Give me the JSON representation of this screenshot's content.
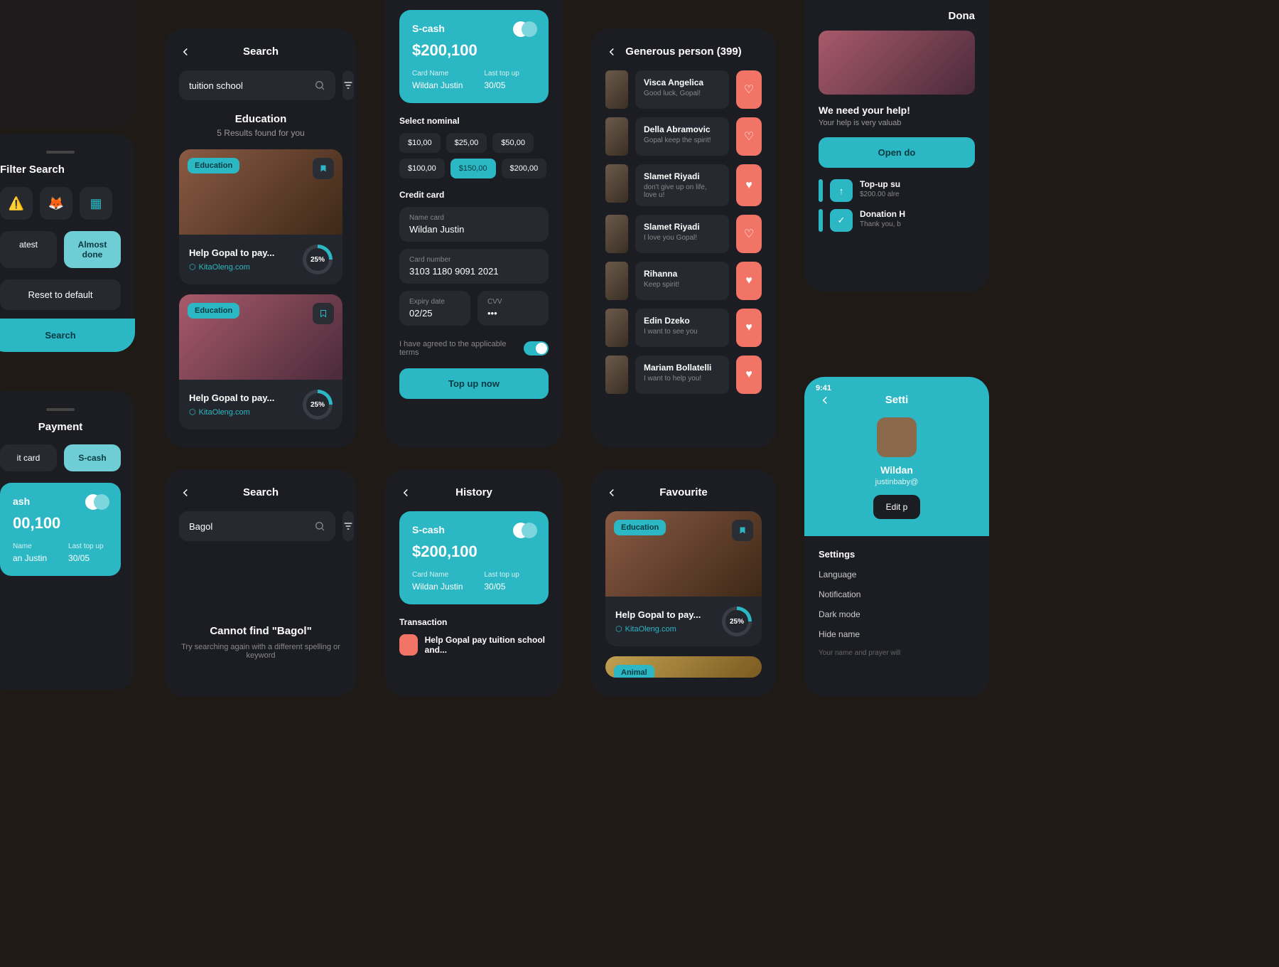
{
  "filter_panel": {
    "title": "Filter Search",
    "icons": [
      "⚠️",
      "🦊",
      "▦"
    ],
    "sort": {
      "latest": "atest",
      "almost_done": "Almost done"
    },
    "reset": "Reset to default",
    "search": "Search"
  },
  "payment_panel": {
    "title": "Payment",
    "tabs": {
      "credit": "it card",
      "scash": "S-cash"
    }
  },
  "scash_card": {
    "name": "S-cash",
    "amount": "$200,100",
    "card_name_label": "Card Name",
    "card_name": "Wildan Justin",
    "topup_label": "Last top up",
    "topup": "30/05"
  },
  "scash_card2": {
    "name": "ash",
    "amount": "00,100",
    "card_name_label": "Name",
    "card_name": "an Justin",
    "topup_label": "Last top up",
    "topup": "30/05"
  },
  "scash_card3": {
    "name": "S-cash",
    "amount": "$200,100",
    "card_name_label": "Card Name",
    "card_name": "Wildan Justin",
    "topup_label": "Last top up",
    "topup": "30/05"
  },
  "search_screen": {
    "title": "Search",
    "query": "tuition school",
    "category": "Education",
    "results_text": "5 Results found for you",
    "cards": [
      {
        "badge": "Education",
        "title": "Help Gopal to pay...",
        "source": "KitaOleng.com",
        "progress": "25%"
      },
      {
        "badge": "Education",
        "title": "Help Gopal to pay...",
        "source": "KitaOleng.com",
        "progress": "25%"
      }
    ]
  },
  "search_empty": {
    "title": "Search",
    "query": "Bagol",
    "nf_title": "Cannot find \"Bagol\"",
    "nf_sub": "Try searching again with a different spelling or keyword"
  },
  "topup_screen": {
    "select_label": "Select nominal",
    "nominals": [
      "$10,00",
      "$25,00",
      "$50,00",
      "$100,00",
      "$150,00",
      "$200,00"
    ],
    "selected_index": 4,
    "cc_label": "Credit card",
    "fields": {
      "name_label": "Name card",
      "name": "Wildan Justin",
      "number_label": "Card number",
      "number": "3103 1180 9091 2021",
      "expiry_label": "Expiry date",
      "expiry": "02/25",
      "cvv_label": "CVV",
      "cvv": "•••"
    },
    "terms": "I have agreed to the applicable terms",
    "button": "Top up now"
  },
  "history_screen": {
    "title": "History",
    "txn_label": "Transaction",
    "txn_item": "Help Gopal pay tuition school and..."
  },
  "generous_screen": {
    "title": "Generous person (399)",
    "people": [
      {
        "name": "Visca Angelica",
        "msg": "Good luck, Gopal!"
      },
      {
        "name": "Della Abramovic",
        "msg": "Gopal keep the spirit!"
      },
      {
        "name": "Slamet Riyadi",
        "msg": "don't give up on life, love u!"
      },
      {
        "name": "Slamet Riyadi",
        "msg": "I love you Gopal!"
      },
      {
        "name": "Rihanna",
        "msg": "Keep spirit!"
      },
      {
        "name": "Edin Dzeko",
        "msg": "I want to see you"
      },
      {
        "name": "Mariam Bollatelli",
        "msg": "I want to help you!"
      }
    ]
  },
  "favourite_screen": {
    "title": "Favourite",
    "card": {
      "badge": "Education",
      "title": "Help Gopal to pay...",
      "source": "KitaOleng.com",
      "progress": "25%"
    },
    "card2_badge": "Animal"
  },
  "donation_panel": {
    "title": "Dona",
    "help_title": "We need your help!",
    "help_sub": "Your help is very valuab",
    "button": "Open do",
    "notifs": [
      {
        "icon": "↑",
        "title": "Top-up su",
        "sub": "$200.00 alre"
      },
      {
        "icon": "✓",
        "title": "Donation H",
        "sub": "Thank you, b"
      }
    ]
  },
  "settings_screen": {
    "time": "9:41",
    "title": "Setti",
    "name": "Wildan",
    "email": "justinbaby@",
    "edit": "Edit p",
    "heading": "Settings",
    "items": [
      "Language",
      "Notification",
      "Dark mode",
      "Hide name"
    ],
    "footer": "Your name and prayer will"
  }
}
